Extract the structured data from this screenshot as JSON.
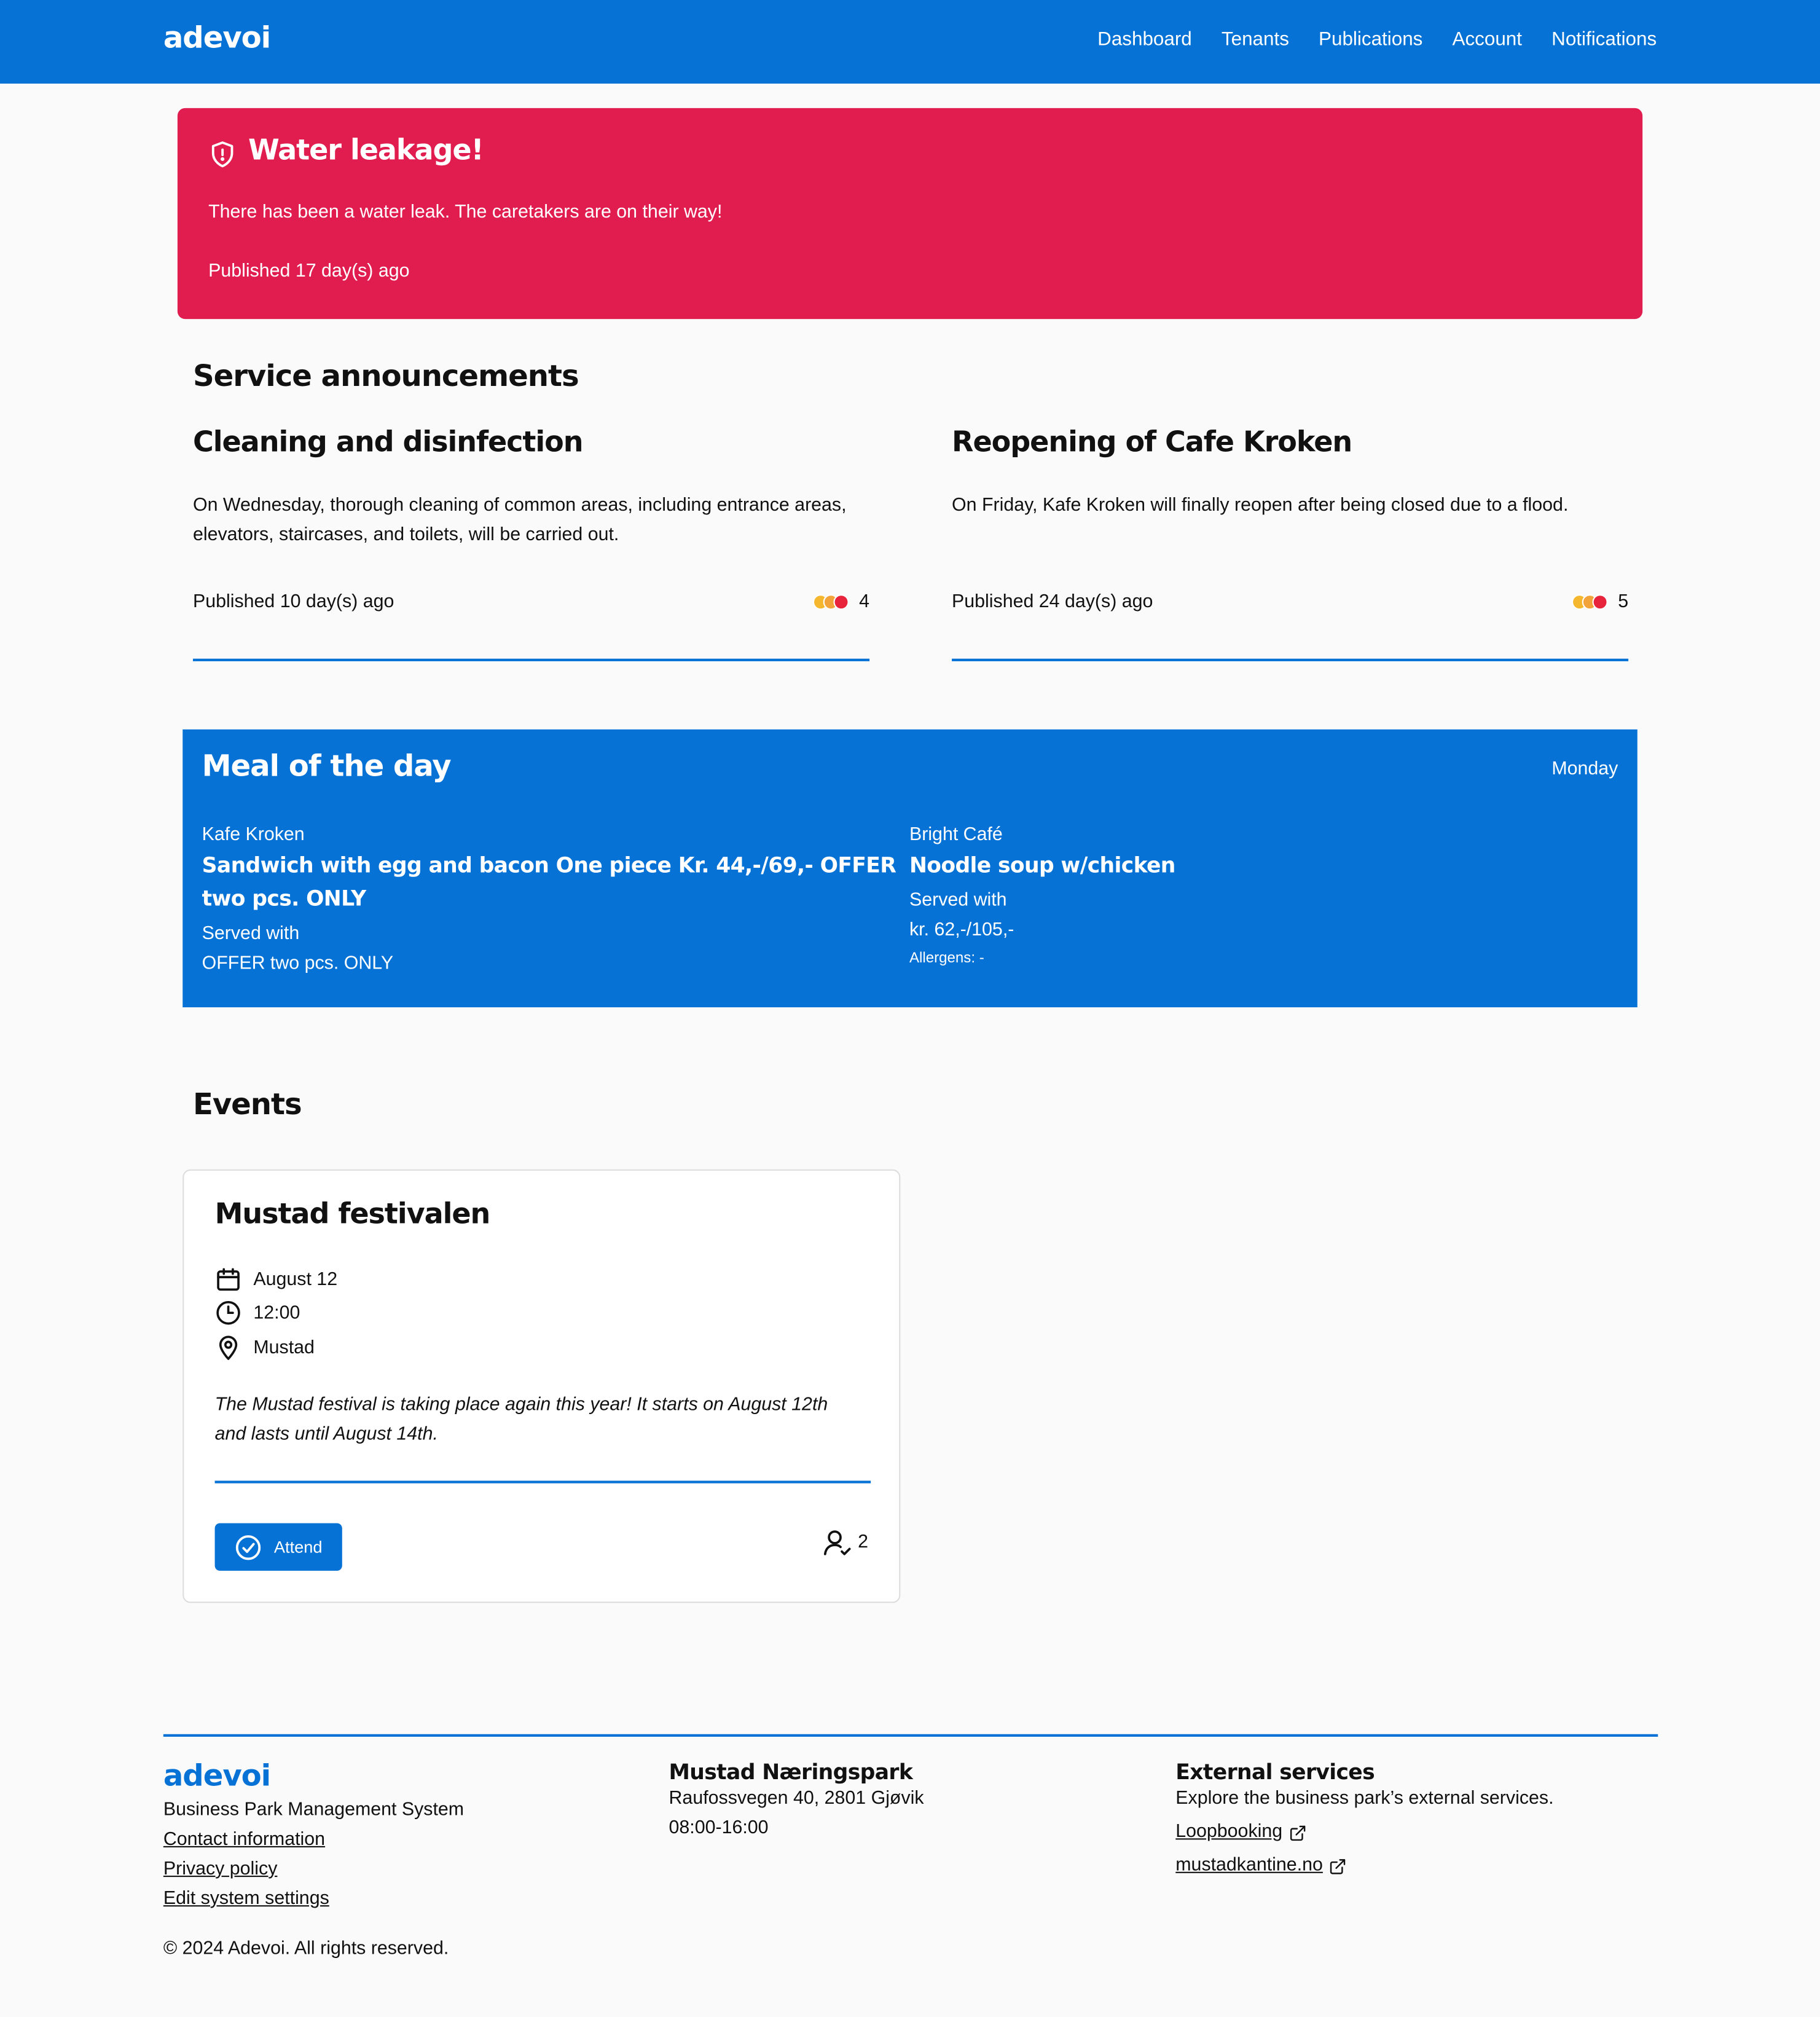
{
  "nav": {
    "logo": "adevoi",
    "items": [
      "Dashboard",
      "Tenants",
      "Publications",
      "Account",
      "Notifications"
    ]
  },
  "alert": {
    "title": "Water leakage!",
    "body": "There has been a water leak. The caretakers are on their way!",
    "published": "Published 17 day(s) ago",
    "color": "#e11d50"
  },
  "service": {
    "title": "Service announcements",
    "items": [
      {
        "title": "Cleaning and disinfection",
        "body": "On Wednesday, thorough cleaning of common areas, including entrance areas, elevators, staircases, and toilets, will be carried out.",
        "published": "Published 10 day(s) ago",
        "reactions": "4"
      },
      {
        "title": "Reopening of Cafe Kroken",
        "body": "On Friday, Kafe Kroken will finally reopen after being closed due to a flood.",
        "published": "Published 24 day(s) ago",
        "reactions": "5"
      }
    ]
  },
  "meal": {
    "title": "Meal of the day",
    "day": "Monday",
    "left": {
      "place": "Kafe Kroken",
      "dish": "Sandwich with egg and bacon One piece Kr. 44,-/69,- OFFER two pcs. ONLY",
      "served_label": "Served with",
      "served": "OFFER two pcs. ONLY"
    },
    "right": {
      "place": "Bright Café",
      "dish": "Noodle soup w/chicken",
      "served_label": "Served with",
      "price": "kr. 62,-/105,-",
      "allergens": "Allergens: -"
    }
  },
  "events": {
    "title": "Events",
    "card": {
      "title": "Mustad festivalen",
      "date": "August 12",
      "time": "12:00",
      "location": "Mustad",
      "description": "The Mustad festival is taking place again this year! It starts on August 12th and lasts until August 14th.",
      "attend_label": "Attend",
      "attendees": "2"
    }
  },
  "footer": {
    "logo": "adevoi",
    "tagline": "Business Park Management System",
    "links": [
      "Contact information",
      "Privacy policy",
      "Edit system settings"
    ],
    "park": {
      "name": "Mustad Næringspark",
      "address": "Raufossvegen 40, 2801 Gjøvik",
      "hours": "08:00-16:00"
    },
    "external": {
      "title": "External services",
      "subtitle": "Explore the business park’s external services.",
      "links": [
        "Loopbooking",
        "mustadkantine.no"
      ]
    },
    "copyright": "© 2024 Adevoi. All rights reserved."
  },
  "colors": {
    "primary": "#0672d6",
    "alert": "#e11d50",
    "background": "#fafafa"
  }
}
